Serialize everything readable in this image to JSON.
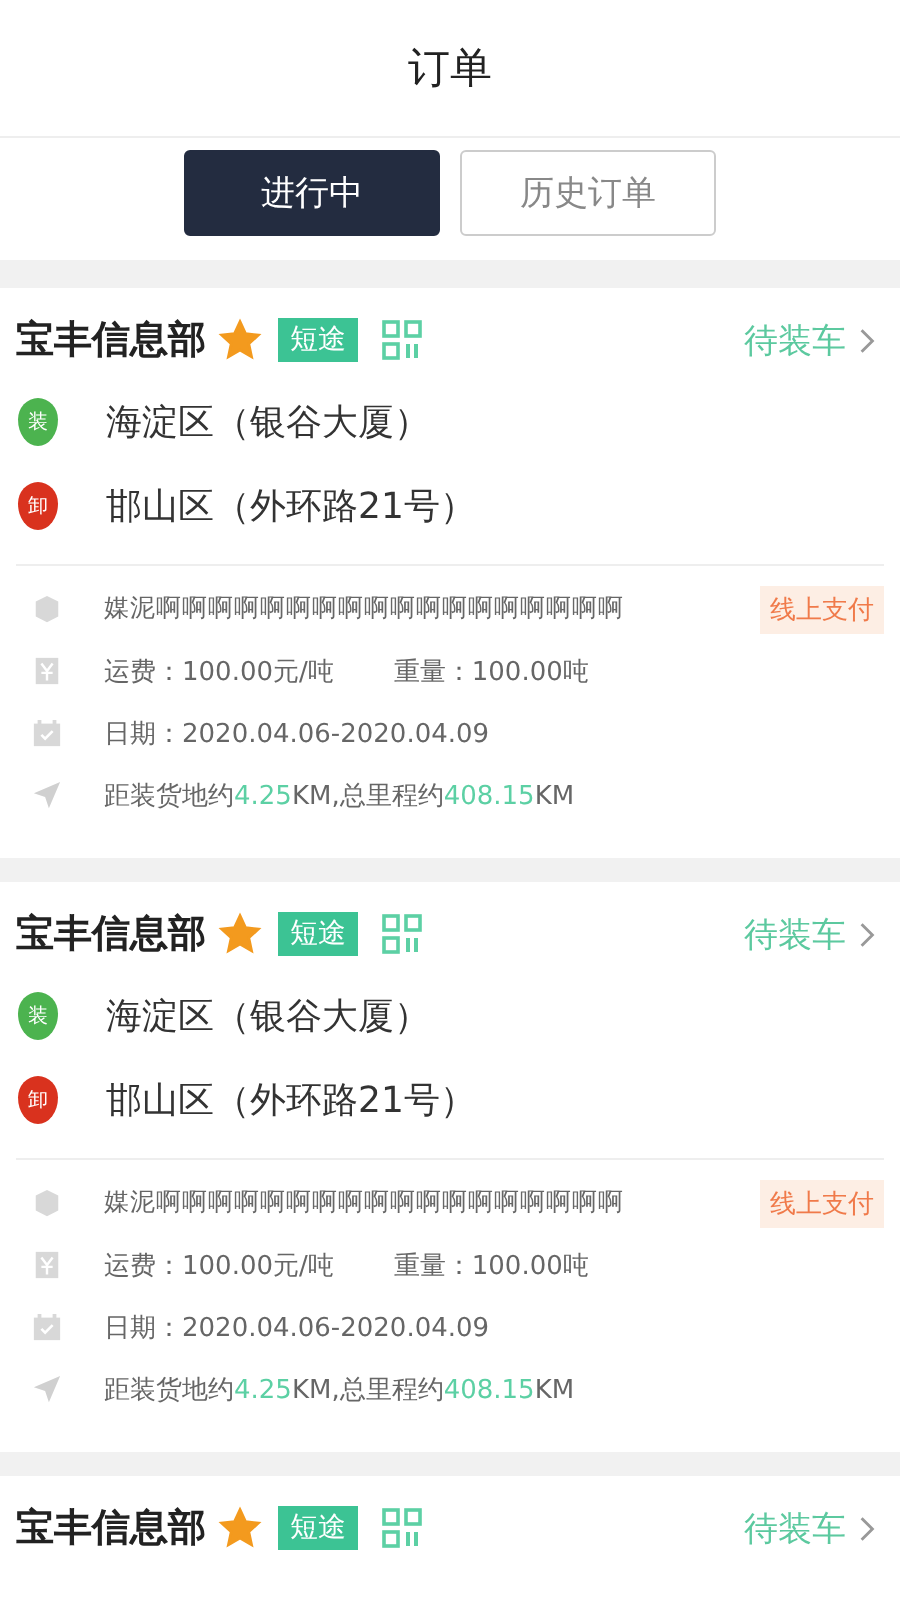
{
  "title": "订单",
  "tabs": [
    {
      "label": "进行中",
      "selected": true
    },
    {
      "label": "历史订单",
      "selected": false
    }
  ],
  "orders": [
    {
      "company": "宝丰信息部",
      "starred": true,
      "tag": "短途",
      "status": "待装车",
      "load": "海淀区（银谷大厦）",
      "load_pin": "装",
      "unload": "邯山区（外环路21号）",
      "unload_pin": "卸",
      "goods": "媒泥啊啊啊啊啊啊啊啊啊啊啊啊啊啊啊啊啊啊",
      "payment": "线上支付",
      "freight": "运费：100.00元/吨",
      "weight": "重量：100.00吨",
      "date": "日期：2020.04.06-2020.04.09",
      "distance": [
        {
          "text": "距装货地约",
          "highlight": false
        },
        {
          "text": "4.25",
          "highlight": true
        },
        {
          "text": "KM,总里程约",
          "highlight": false
        },
        {
          "text": "408.15",
          "highlight": true
        },
        {
          "text": "KM",
          "highlight": false
        }
      ]
    },
    {
      "company": "宝丰信息部",
      "starred": true,
      "tag": "短途",
      "status": "待装车",
      "load": "海淀区（银谷大厦）",
      "load_pin": "装",
      "unload": "邯山区（外环路21号）",
      "unload_pin": "卸",
      "goods": "媒泥啊啊啊啊啊啊啊啊啊啊啊啊啊啊啊啊啊啊",
      "payment": "线上支付",
      "freight": "运费：100.00元/吨",
      "weight": "重量：100.00吨",
      "date": "日期：2020.04.06-2020.04.09",
      "distance": [
        {
          "text": "距装货地约",
          "highlight": false
        },
        {
          "text": "4.25",
          "highlight": true
        },
        {
          "text": "KM,总里程约",
          "highlight": false
        },
        {
          "text": "408.15",
          "highlight": true
        },
        {
          "text": "KM",
          "highlight": false
        }
      ]
    },
    {
      "company": "宝丰信息部",
      "starred": true,
      "tag": "短途",
      "status": "待装车"
    }
  ]
}
